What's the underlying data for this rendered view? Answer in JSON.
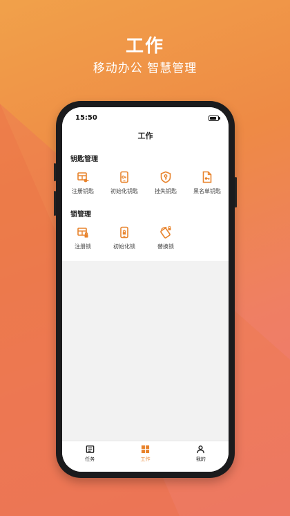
{
  "banner": {
    "title": "工作",
    "subtitle": "移动办公 智慧管理"
  },
  "status_bar": {
    "time": "15:50"
  },
  "header": {
    "title": "工作"
  },
  "sections": [
    {
      "title": "钥匙管理",
      "items": [
        {
          "label": "注册钥匙",
          "icon": "register-key-icon"
        },
        {
          "label": "初始化钥匙",
          "icon": "phone-key-icon"
        },
        {
          "label": "挂失钥匙",
          "icon": "shield-key-icon"
        },
        {
          "label": "黑名单钥匙",
          "icon": "blacklist-key-icon"
        }
      ]
    },
    {
      "title": "锁管理",
      "items": [
        {
          "label": "注册锁",
          "icon": "register-lock-icon"
        },
        {
          "label": "初始化锁",
          "icon": "phone-lock-icon"
        },
        {
          "label": "替换锁",
          "icon": "replace-lock-icon"
        }
      ]
    }
  ],
  "tabbar": {
    "tabs": [
      {
        "label": "任务",
        "icon": "list-icon",
        "active": false
      },
      {
        "label": "工作",
        "icon": "grid-icon",
        "active": true
      },
      {
        "label": "我的",
        "icon": "person-icon",
        "active": false
      }
    ]
  },
  "colors": {
    "accent": "#e8832c",
    "background_top": "#f1a14a",
    "background_bottom": "#ee7676"
  }
}
